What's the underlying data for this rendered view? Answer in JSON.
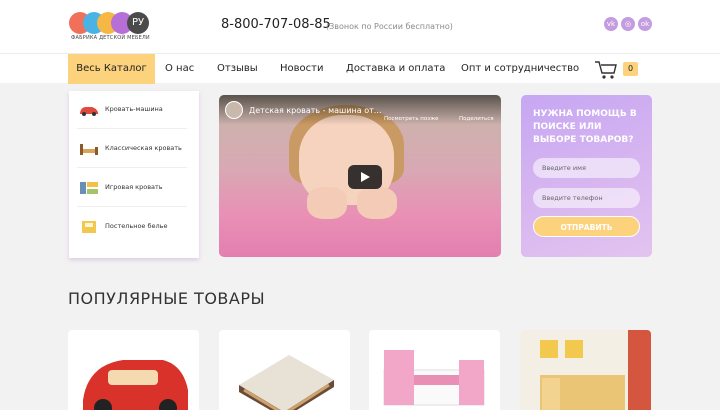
{
  "brand": {
    "ru_label": "РУ",
    "subtitle": "ФАБРИКА ДЕТСКОЙ МЕБЕЛИ",
    "circle_colors": [
      "#f0705a",
      "#49b3e6",
      "#f6b844",
      "#b56fd6"
    ]
  },
  "header": {
    "phone": "8-800-707-08-85",
    "phone_note": "(Звонок по России бесплатно)",
    "social": [
      "vk-icon",
      "instagram-icon",
      "odnoklassniki-icon"
    ]
  },
  "nav": {
    "catalog": "Весь Каталог",
    "items": [
      "О нас",
      "Отзывы",
      "Новости",
      "Доставка и оплата",
      "Опт и сотрудничество"
    ],
    "cart_count": "0"
  },
  "catalog_menu": {
    "items": [
      {
        "label": "Кровать-машина",
        "icon": "car-bed-icon"
      },
      {
        "label": "Классическая кровать",
        "icon": "classic-bed-icon"
      },
      {
        "label": "Игровая кровать",
        "icon": "play-bed-icon"
      },
      {
        "label": "Постельное белье",
        "icon": "bedding-icon"
      }
    ]
  },
  "video": {
    "title": "Детская кровать - машина от...",
    "watch_later": "Посмотреть позже",
    "share": "Поделиться"
  },
  "help": {
    "title": "НУЖНА ПОМОЩЬ В ПОИСКЕ ИЛИ ВЫБОРЕ ТОВАРОВ?",
    "name_placeholder": "Введите имя",
    "phone_placeholder": "Введите телефон",
    "send": "ОТПРАВИТЬ"
  },
  "popular": {
    "title": "ПОПУЛЯРНЫЕ ТОВАРЫ"
  },
  "colors": {
    "accent": "#fcd37c",
    "purple": "#c6a7f2"
  }
}
